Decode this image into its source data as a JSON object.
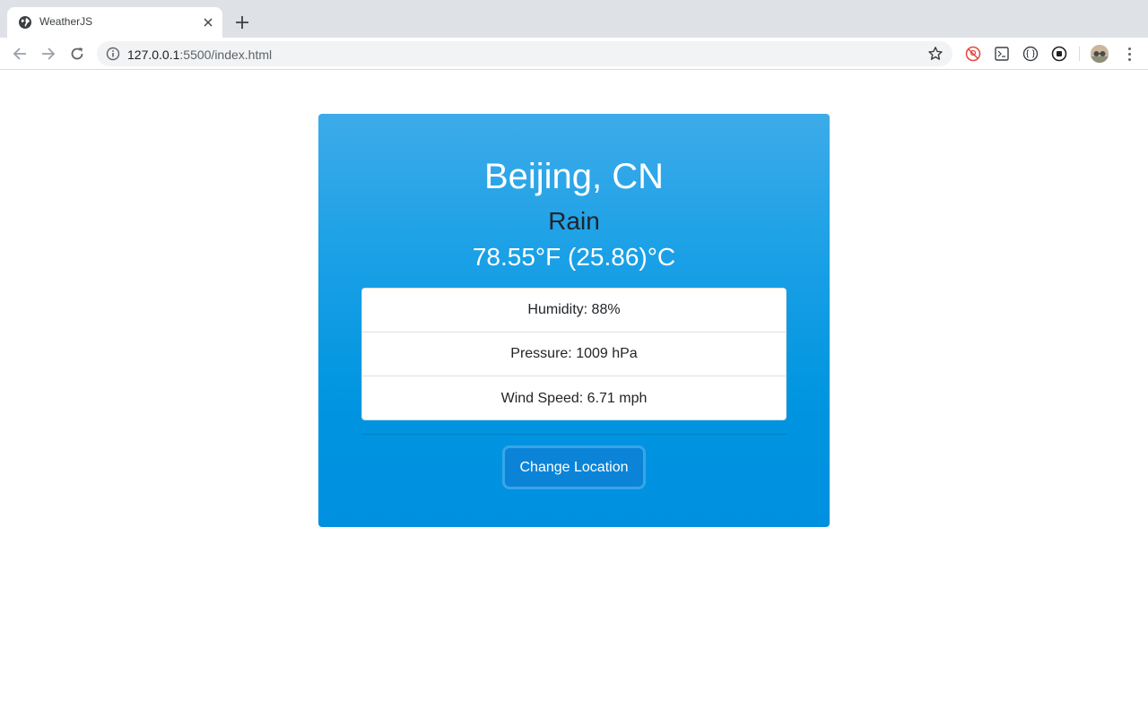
{
  "browser": {
    "tab_title": "WeatherJS",
    "url_host": "127.0.0.1",
    "url_rest": ":5500/index.html"
  },
  "weather": {
    "location": "Beijing, CN",
    "description": "Rain",
    "temperature": "78.55°F (25.86)°C",
    "details": [
      {
        "label": "Humidity: 88%"
      },
      {
        "label": "Pressure: 1009 hPa"
      },
      {
        "label": "Wind Speed: 6.71 mph"
      }
    ],
    "change_button_label": "Change Location"
  },
  "colors": {
    "card_top": "#3dabe9",
    "card_bottom": "#0090e0",
    "button": "#0b84d8"
  },
  "icons": {
    "favicon": "globe-icon",
    "back": "arrow-left-icon",
    "forward": "arrow-right-icon",
    "reload": "reload-icon",
    "site_info": "info-icon",
    "bookmark": "star-icon",
    "menu": "kebab-menu-icon"
  }
}
